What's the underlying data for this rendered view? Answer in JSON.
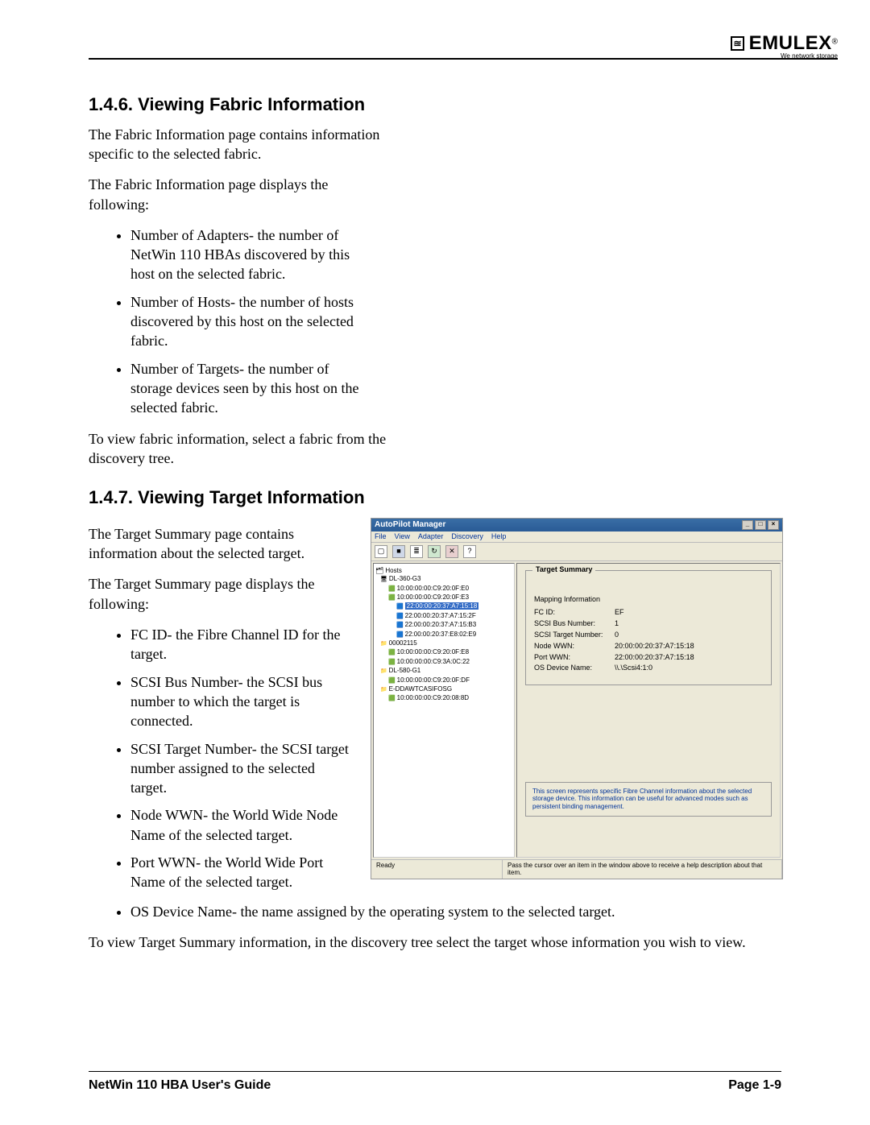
{
  "brand": {
    "mark": "≊",
    "name": "EMULEX",
    "sup": "®",
    "tag": "We network storage"
  },
  "sec146": {
    "heading": "1.4.6.  Viewing Fabric Information",
    "p1": "The Fabric Information page contains information specific to the selected fabric.",
    "p2": "The Fabric Information page displays the following:",
    "bullets": [
      "Number of Adapters- the number of NetWin 110 HBAs discovered by this host on the selected fabric.",
      "Number of Hosts- the number of hosts discovered by this host on the selected fabric.",
      "Number of Targets- the number of storage devices seen by this host on the selected fabric."
    ],
    "p3": "To view fabric information, select a fabric from the discovery tree."
  },
  "sec147": {
    "heading": "1.4.7.  Viewing Target Information",
    "p1": "The Target Summary page contains information about the selected target.",
    "p2": "The Target Summary page displays the following:",
    "bullets": [
      "FC ID- the Fibre Channel ID for the target.",
      "SCSI Bus Number- the SCSI bus number to which the target is connected.",
      "SCSI Target Number- the SCSI target number assigned to the selected target.",
      "Node WWN- the World Wide Node Name of the selected target.",
      "Port WWN- the World Wide Port Name of the selected target.",
      "OS Device Name- the name assigned by the operating system to the selected target."
    ],
    "p3": "To view Target Summary information, in the discovery tree select the target whose information you wish to view."
  },
  "app": {
    "title": "AutoPilot Manager",
    "win_buttons": [
      "_",
      "□",
      "×"
    ],
    "menu": [
      "File",
      "View",
      "Adapter",
      "Discovery",
      "Help"
    ],
    "tree_root": "Hosts",
    "tree": [
      {
        "lv": 1,
        "cls": "ico-host",
        "t": "DL-360-G3"
      },
      {
        "lv": 2,
        "cls": "ico-adp",
        "t": "10:00:00:00:C9:20:0F:E0"
      },
      {
        "lv": 2,
        "cls": "ico-adp",
        "t": "10:00:00:00:C9:20:0F:E3"
      },
      {
        "lv": 3,
        "cls": "ico-fab",
        "t": "22:00:00:20:37:A7:15:18",
        "sel": true
      },
      {
        "lv": 3,
        "cls": "ico-fab",
        "t": "22:00:00:20:37:A7:15:2F"
      },
      {
        "lv": 3,
        "cls": "ico-fab",
        "t": "22:00:00:20:37:A7:15:B3"
      },
      {
        "lv": 3,
        "cls": "ico-fab",
        "t": "22:00:00:20:37:E8:02:E9"
      },
      {
        "lv": 1,
        "cls": "ico-grp",
        "t": "00002115"
      },
      {
        "lv": 2,
        "cls": "ico-adp",
        "t": "10:00:00:00:C9:20:0F:E8"
      },
      {
        "lv": 2,
        "cls": "ico-adp",
        "t": "10:00:00:00:C9:3A:0C:22"
      },
      {
        "lv": 1,
        "cls": "ico-grp",
        "t": "DL-580-G1"
      },
      {
        "lv": 2,
        "cls": "ico-adp",
        "t": "10:00:00:00:C9:20:0F:DF"
      },
      {
        "lv": 1,
        "cls": "ico-grp",
        "t": "E-DDAWTCASIFOSG"
      },
      {
        "lv": 2,
        "cls": "ico-adp",
        "t": "10:00:00:00:C9:20:08:8D"
      }
    ],
    "panel_title": "Target Summary",
    "group_title": "Mapping Information",
    "kv": [
      {
        "k": "FC ID:",
        "v": "EF"
      },
      {
        "k": "SCSI Bus Number:",
        "v": "1"
      },
      {
        "k": "SCSI Target Number:",
        "v": "0"
      },
      {
        "k": "Node WWN:",
        "v": "20:00:00:20:37:A7:15:18"
      },
      {
        "k": "Port WWN:",
        "v": "22:00:00:20:37:A7:15:18"
      },
      {
        "k": "OS Device Name:",
        "v": "\\\\.\\Scsi4:1:0"
      }
    ],
    "info": "This screen represents specific Fibre Channel information about the selected storage device. This information can be useful for advanced modes such as persistent binding management.",
    "status_left": "Ready",
    "status_right": "Pass the cursor over an item in the window above to receive a help description about that item."
  },
  "footer": {
    "left": "NetWin 110 HBA User's Guide",
    "right": "Page 1-9"
  }
}
